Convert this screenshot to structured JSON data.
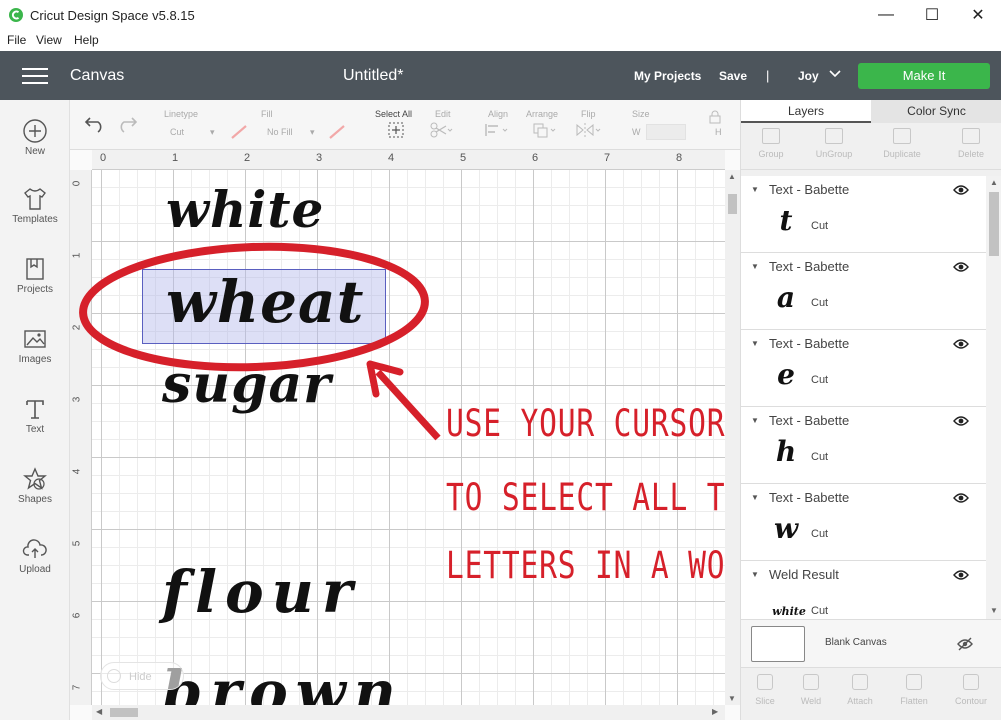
{
  "window": {
    "title": "Cricut Design Space  v5.8.15",
    "minimize": "—",
    "maximize": "☐",
    "close": "✕"
  },
  "menu": [
    "File",
    "View",
    "Help"
  ],
  "header": {
    "section": "Canvas",
    "doc_title": "Untitled*",
    "my_projects": "My Projects",
    "save": "Save",
    "separator": "|",
    "user": "Joy",
    "make_it": "Make It",
    "make_it_color": "#3bb64b"
  },
  "left_nav": [
    {
      "label": "New",
      "icon": "plus-circle-icon"
    },
    {
      "label": "Templates",
      "icon": "tshirt-icon"
    },
    {
      "label": "Projects",
      "icon": "projects-icon"
    },
    {
      "label": "Images",
      "icon": "image-icon"
    },
    {
      "label": "Text",
      "icon": "text-icon"
    },
    {
      "label": "Shapes",
      "icon": "shapes-icon"
    },
    {
      "label": "Upload",
      "icon": "upload-icon"
    }
  ],
  "toolbar": {
    "linetype_label": "Linetype",
    "linetype_value": "Cut",
    "fill_label": "Fill",
    "fill_value": "No Fill",
    "select_all": "Select All",
    "edit": "Edit",
    "align": "Align",
    "arrange": "Arrange",
    "flip": "Flip",
    "size": "Size",
    "size_w": "W",
    "size_h": "H"
  },
  "ruler": {
    "top": [
      "0",
      "1",
      "2",
      "3",
      "4",
      "5",
      "6",
      "7",
      "8"
    ],
    "left": [
      "0",
      "1",
      "2",
      "3",
      "4",
      "5",
      "6",
      "7"
    ]
  },
  "canvas": {
    "words": [
      "white",
      "wheat",
      "sugar",
      "flour",
      "brown"
    ],
    "annotation": [
      "USE YOUR CURSOR",
      "TO SELECT ALL THE",
      "LETTERS IN A WORD"
    ],
    "annotation_color": "#d6202a",
    "hide_label": "Hide"
  },
  "panel": {
    "tabs": [
      "Layers",
      "Color Sync"
    ],
    "tools": [
      "Group",
      "UnGroup",
      "Duplicate",
      "Delete"
    ],
    "layers": [
      {
        "name": "Text - Babette",
        "glyph": "t",
        "op": "Cut"
      },
      {
        "name": "Text - Babette",
        "glyph": "a",
        "op": "Cut"
      },
      {
        "name": "Text - Babette",
        "glyph": "e",
        "op": "Cut"
      },
      {
        "name": "Text - Babette",
        "glyph": "h",
        "op": "Cut"
      },
      {
        "name": "Text - Babette",
        "glyph": "w",
        "op": "Cut"
      },
      {
        "name": "Weld Result",
        "glyph": "white",
        "op": "Cut"
      }
    ],
    "blank_canvas": "Blank Canvas",
    "bottom_tools": [
      "Slice",
      "Weld",
      "Attach",
      "Flatten",
      "Contour"
    ]
  }
}
